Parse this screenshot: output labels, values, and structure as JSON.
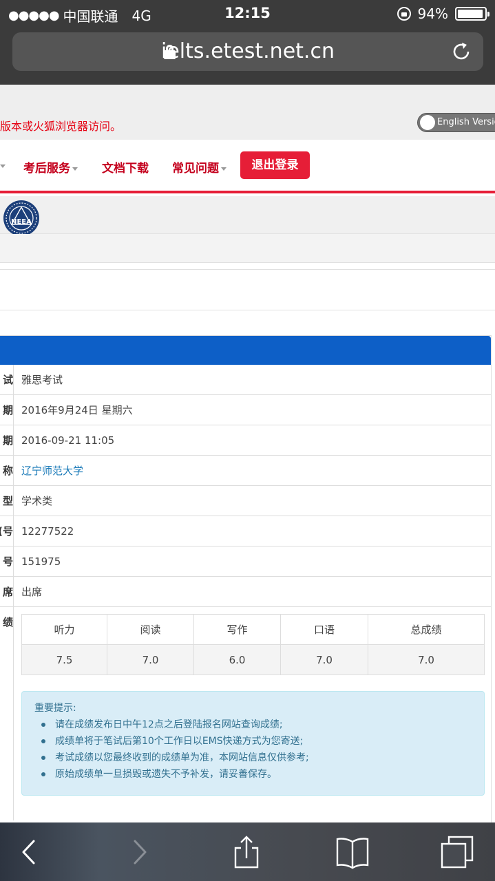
{
  "status_bar": {
    "signal": "●●●●●",
    "carrier": "中国联通",
    "network": "4G",
    "time": "12:15",
    "battery_percent": "94%",
    "battery_level": 0.94,
    "icons": [
      "rotation-lock-icon",
      "battery-icon"
    ]
  },
  "browser": {
    "url_host": "ielts.etest.net.cn",
    "icons": [
      "lock-icon",
      "reload-icon",
      "back-icon",
      "forward-icon",
      "share-icon",
      "bookmarks-icon",
      "tabs-icon"
    ]
  },
  "header": {
    "browser_notice": "版本或火狐浏览器访问。",
    "lang_toggle_label": "English Versio"
  },
  "nav": {
    "items": [
      {
        "label": "考后服务",
        "has_dropdown": true
      },
      {
        "label": "文档下载",
        "has_dropdown": false
      },
      {
        "label": "常见问题",
        "has_dropdown": true
      }
    ],
    "logout_label": "退出登录",
    "logo_text": "NEEA"
  },
  "exam_info": {
    "rows": [
      {
        "key": "试",
        "value": "雅思考试"
      },
      {
        "key": "期",
        "value": "2016年9月24日 星期六"
      },
      {
        "key": "期",
        "value": "2016-09-21 11:05"
      },
      {
        "key": "称",
        "value": "辽宁师范大学"
      },
      {
        "key": "型",
        "value": "学术类"
      },
      {
        "key": "号)",
        "value": "12277522"
      },
      {
        "key": "号",
        "value": "151975"
      },
      {
        "key": "席",
        "value": "出席"
      }
    ],
    "score_key": "绩"
  },
  "scores": {
    "headers": [
      "听力",
      "阅读",
      "写作",
      "口语",
      "总成绩"
    ],
    "values": [
      "7.5",
      "7.0",
      "6.0",
      "7.0",
      "7.0"
    ]
  },
  "tips": {
    "title": "重要提示:",
    "items": [
      "请在成绩发布日中午12点之后登陆报名网站查询成绩;",
      "成绩单将于笔试后第10个工作日以EMS快递方式为您寄送;",
      "考试成绩以您最终收到的成绩单为准，本网站信息仅供参考;",
      "原始成绩单一旦损毁或遗失不予补发，请妥善保存。"
    ]
  },
  "colors": {
    "brand_red": "#e61e37",
    "nav_text": "#c4001d",
    "panel_blue": "#0d5fc7",
    "tip_bg": "#d9edf7",
    "tip_text": "#31708f"
  }
}
